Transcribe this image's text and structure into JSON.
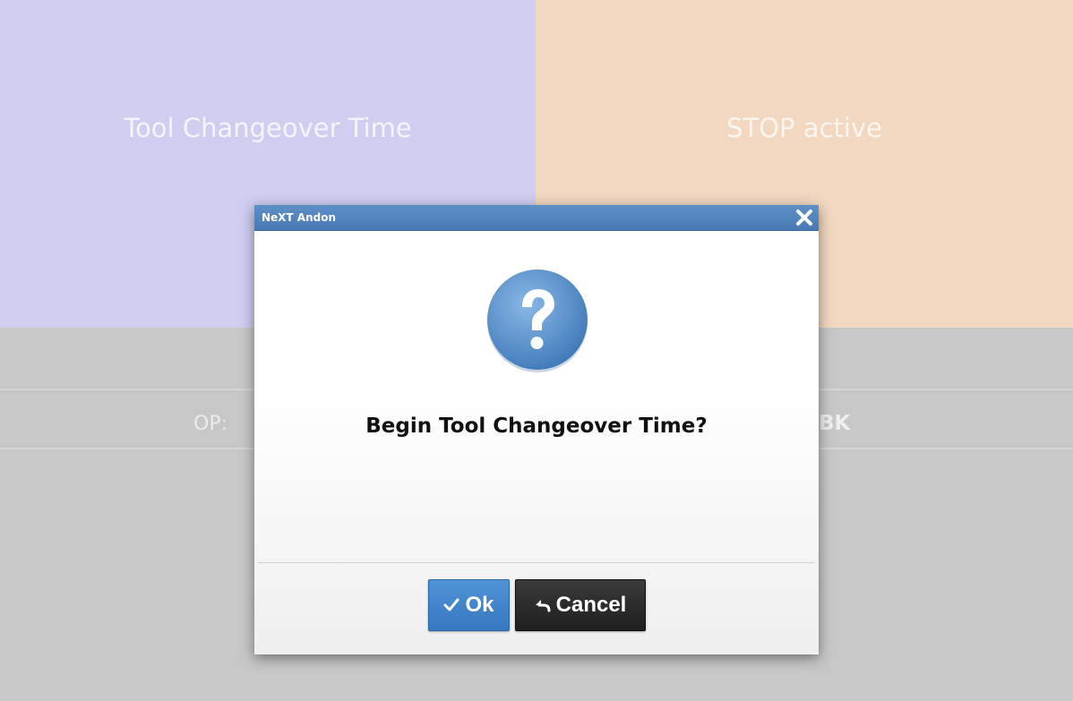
{
  "tiles": {
    "tool_changeover": {
      "label": "Tool Changeover Time",
      "color": "#cfcdf0"
    },
    "stop": {
      "label": "STOP active",
      "color": "#f2d8c0"
    }
  },
  "background_panel": {
    "op_label": "OP:",
    "bk_label": "BK",
    "color": "#c7c7c7"
  },
  "dialog": {
    "title": "NeXT Andon",
    "close_icon": "close-icon",
    "icon": "question-icon",
    "message": "Begin Tool Changeover Time?",
    "ok_label": "Ok",
    "ok_icon": "check-icon",
    "cancel_label": "Cancel",
    "cancel_icon": "reply-arrow-icon",
    "accent_color": "#4a7ab5"
  }
}
